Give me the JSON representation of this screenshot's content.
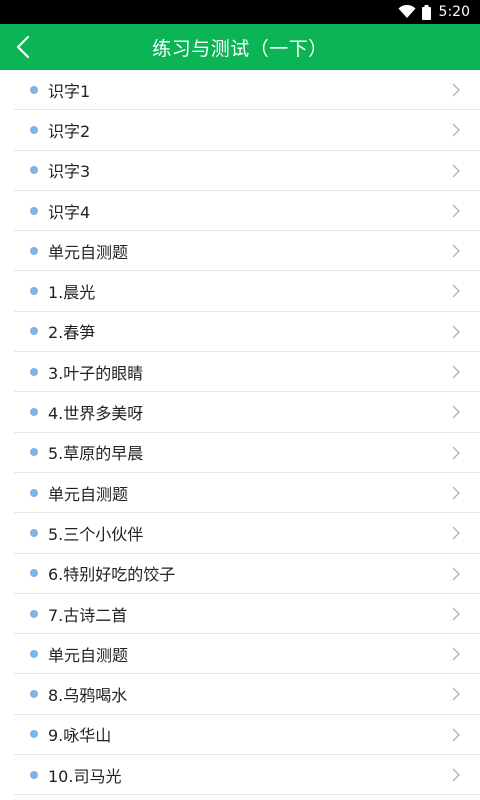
{
  "status": {
    "time": "5:20"
  },
  "header": {
    "title": "练习与测试（一下）"
  },
  "colors": {
    "accent": "#0bb455",
    "bullet": "#7fb3e8",
    "chevron": "#b0b0b0"
  },
  "icons": {
    "back": "chevron-left-icon",
    "row_arrow": "chevron-right-icon",
    "bullet": "dot-icon"
  },
  "list": [
    "识字1",
    "识字2",
    "识字3",
    "识字4",
    "单元自测题",
    "1.晨光",
    "2.春笋",
    "3.叶子的眼睛",
    "4.世界多美呀",
    "5.草原的早晨",
    "单元自测题",
    "5.三个小伙伴",
    "6.特别好吃的饺子",
    "7.古诗二首",
    "单元自测题",
    "8.乌鸦喝水",
    "9.咏华山",
    "10.司马光"
  ]
}
